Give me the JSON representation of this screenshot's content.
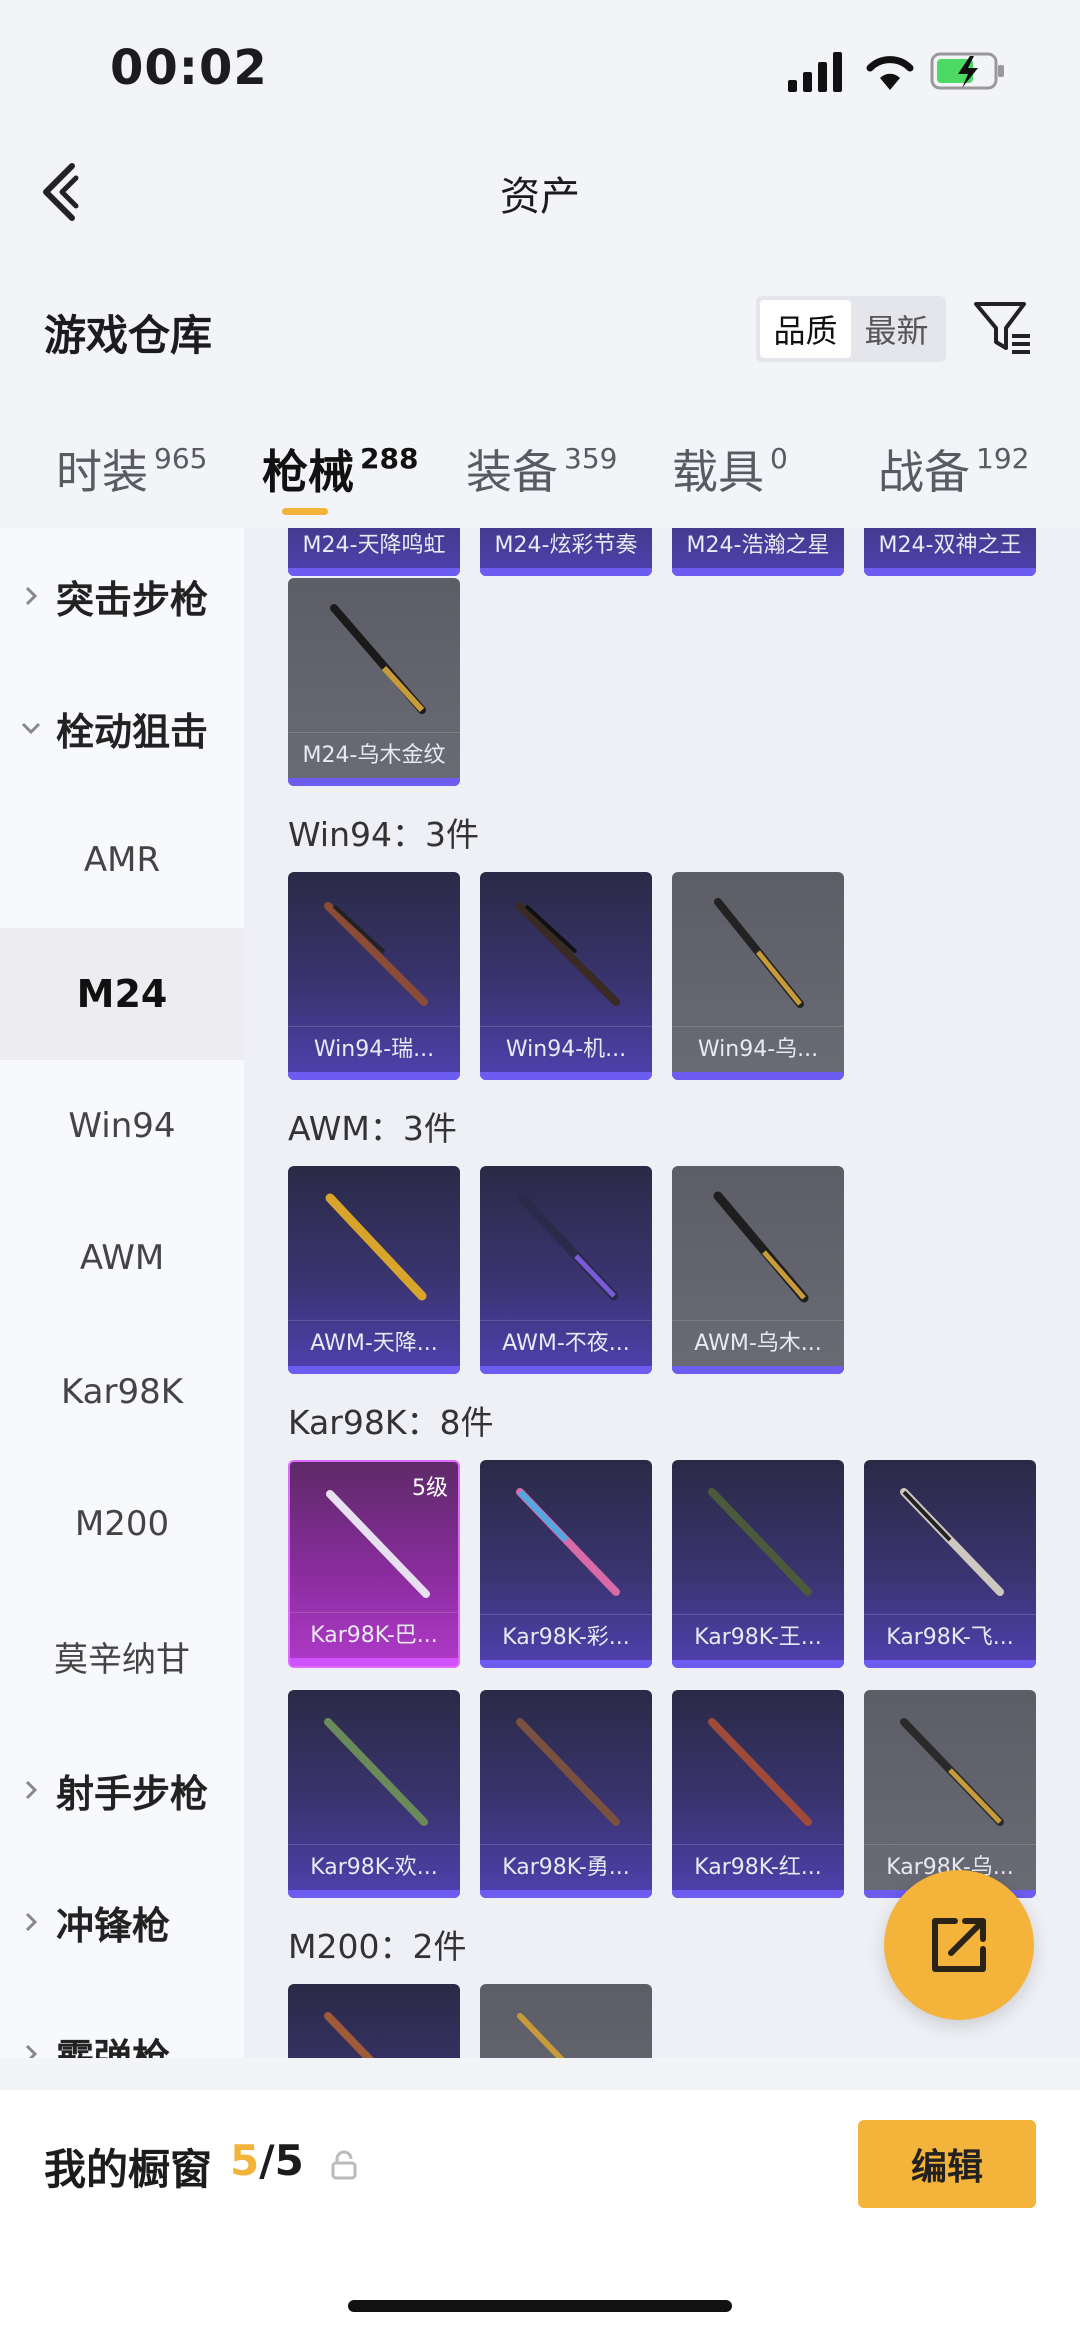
{
  "status": {
    "time": "00:02"
  },
  "nav": {
    "title": "资产"
  },
  "section": {
    "title": "游戏仓库",
    "sort_options": [
      "品质",
      "最新"
    ]
  },
  "tabs": [
    {
      "label": "时装",
      "count": "965"
    },
    {
      "label": "枪械",
      "count": "288"
    },
    {
      "label": "装备",
      "count": "359"
    },
    {
      "label": "载具",
      "count": "0"
    },
    {
      "label": "战备",
      "count": "192"
    }
  ],
  "sidebar": {
    "items": [
      "突击步枪",
      "栓动狙击",
      "AMR",
      "M24",
      "Win94",
      "AWM",
      "Kar98K",
      "M200",
      "莫辛纳甘",
      "射手步枪",
      "冲锋枪",
      "霰弹枪"
    ]
  },
  "groups": {
    "top_partial": [
      "M24-天降鸣虹",
      "M24-炫彩节奏",
      "M24-浩瀚之星",
      "M24-双神之王"
    ],
    "m24_last": "M24-乌木金纹",
    "win94": {
      "title": "Win94：3件",
      "cards": [
        "Win94-瑞...",
        "Win94-机...",
        "Win94-乌..."
      ]
    },
    "awm": {
      "title": "AWM：3件",
      "cards": [
        "AWM-天降...",
        "AWM-不夜...",
        "AWM-乌木..."
      ]
    },
    "kar98k": {
      "title": "Kar98K：8件",
      "row1": [
        "Kar98K-巴...",
        "Kar98K-彩...",
        "Kar98K-王...",
        "Kar98K-飞..."
      ],
      "row2": [
        "Kar98K-欢...",
        "Kar98K-勇...",
        "Kar98K-红...",
        "Kar98K-乌..."
      ],
      "level": "5级"
    },
    "m200": {
      "title": "M200：2件"
    }
  },
  "bottom": {
    "label": "我的橱窗",
    "current": "5",
    "total": "/5",
    "edit": "编辑"
  }
}
